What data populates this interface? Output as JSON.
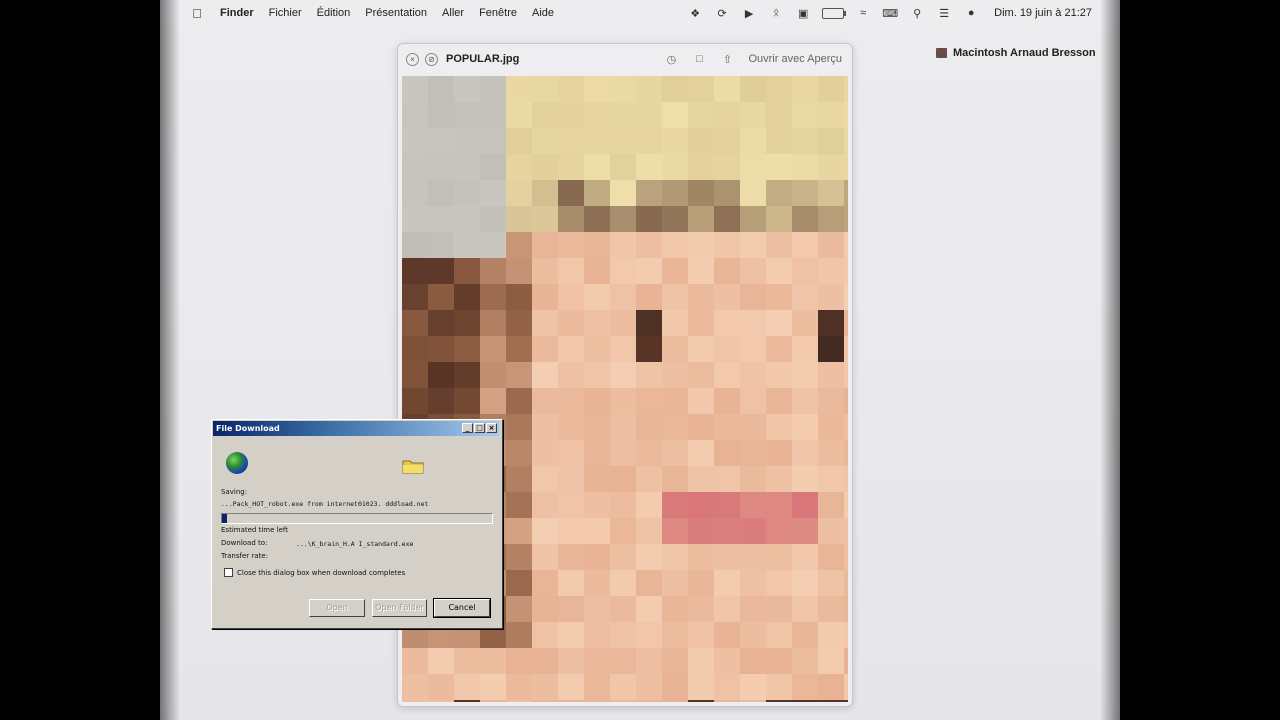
{
  "menubar": {
    "app_name": "Finder",
    "items": [
      "Fichier",
      "Édition",
      "Présentation",
      "Aller",
      "Fenêtre",
      "Aide"
    ],
    "clock": "Dim. 19 juin à  21:27",
    "status_icons": [
      "dropbox-icon",
      "sync-icon",
      "play-icon",
      "bluetooth-icon",
      "display-icon",
      "battery-icon",
      "wifi-icon",
      "keyboard-icon",
      "search-icon",
      "control-center-icon",
      "user-icon"
    ]
  },
  "desktop": {
    "drive_label": "Macintosh Arnaud Bresson"
  },
  "quicklook": {
    "title": "POPULAR.jpg",
    "open_with": "Ouvrir avec Aperçu"
  },
  "dialog": {
    "title": "File Download",
    "saving_label": "Saving:",
    "saving_file": "...Pack_HOT_robot.exe from internet01023. dddload.net",
    "estimated_label": "Estimated time left",
    "download_to_label": "Download to:",
    "download_to_value": "...\\K_brain_H.A I_standard.exe",
    "transfer_label": "Transfer rate:",
    "close_checkbox_label": "Close this dialog box when download completes",
    "progress": 0.02,
    "buttons": {
      "open": "Open",
      "open_folder": "Open Folder",
      "cancel": "Cancel"
    }
  }
}
